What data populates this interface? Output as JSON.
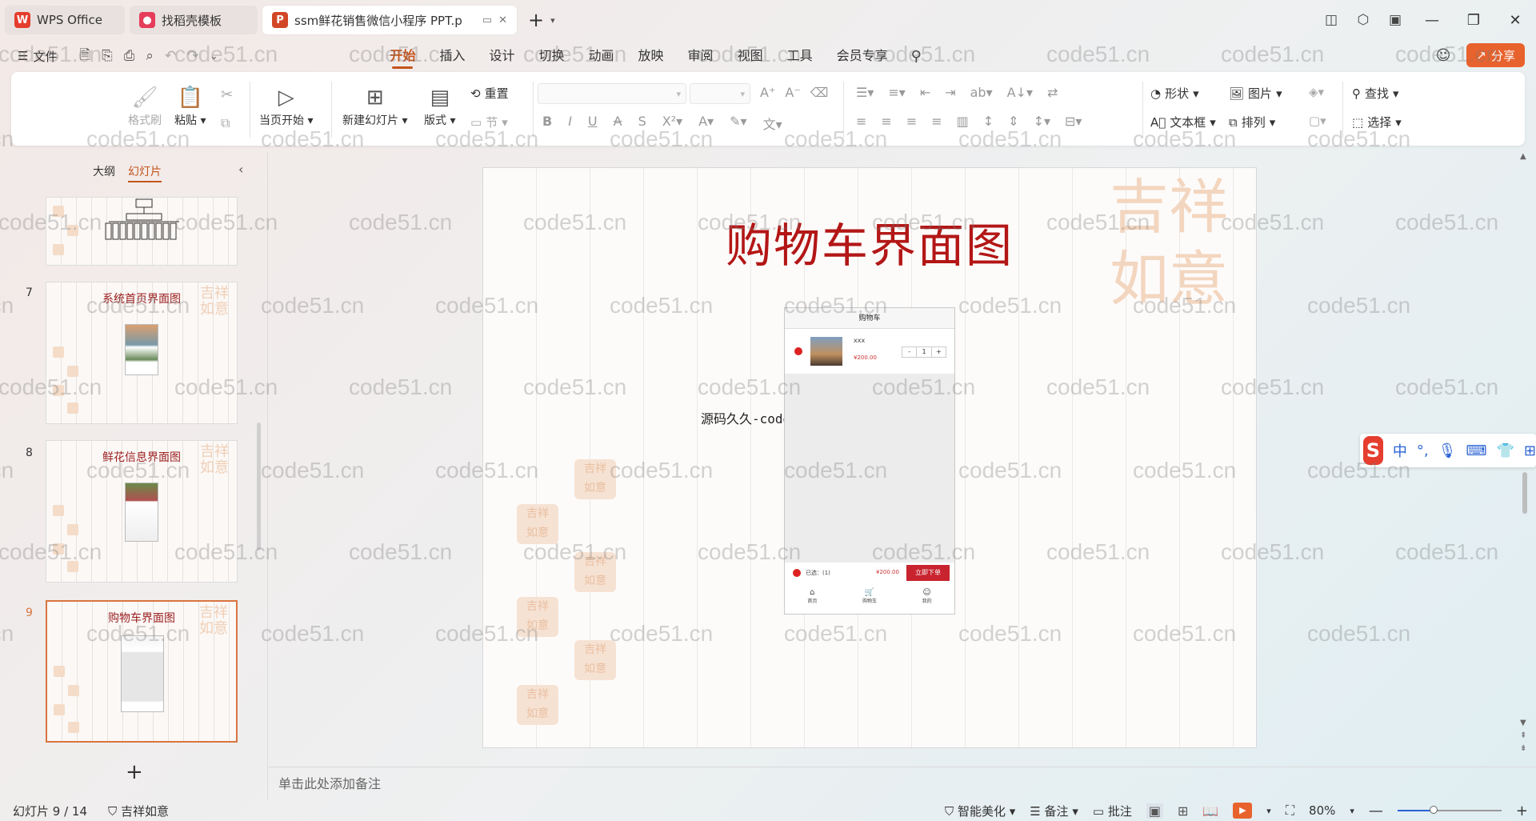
{
  "tabs": [
    {
      "label": "WPS Office",
      "icon": "wps-logo-icon",
      "color": "#e53d2e"
    },
    {
      "label": "找稻壳模板",
      "icon": "docer-logo-icon",
      "color": "#e53d5a"
    },
    {
      "label": "ssm鲜花销售微信小程序 PPT.p",
      "icon": "ppt-logo-icon",
      "color": "#d24726",
      "logo_letter": "P"
    }
  ],
  "menu": {
    "file_label": "文件",
    "tabs": [
      "开始",
      "插入",
      "设计",
      "切换",
      "动画",
      "放映",
      "审阅",
      "视图",
      "工具",
      "会员专享"
    ],
    "active_tab": "开始",
    "share_label": "分享"
  },
  "ribbon": {
    "format_painter": "格式刷",
    "paste": "粘贴",
    "play_current": "当页开始",
    "new_slide": "新建幻灯片",
    "layout": "版式",
    "reset": "重置",
    "section": "节",
    "shape": "形状",
    "picture": "图片",
    "textbox": "文本框",
    "arrange": "排列",
    "find": "查找",
    "select": "选择"
  },
  "left_panel": {
    "tab_outline": "大纲",
    "tab_slides": "幻灯片",
    "active_tab": "幻灯片",
    "thumbnails": [
      {
        "num": "7",
        "title": "系统首页界面图"
      },
      {
        "num": "8",
        "title": "鲜花信息界面图"
      },
      {
        "num": "9",
        "title": "购物车界面图",
        "selected": true
      }
    ]
  },
  "slide": {
    "title": "购物车界面图",
    "deco_text": "吉祥如意",
    "source_note": "源码久久-code99.top",
    "phone": {
      "header": "购物车",
      "item_name": "xxx",
      "item_price": "¥200.00",
      "qty_minus": "-",
      "qty": "1",
      "qty_plus": "+",
      "selected_label": "已选：(1)",
      "total": "¥200.00",
      "order_button": "立即下单",
      "nav": [
        "首页",
        "购物车",
        "我的"
      ]
    }
  },
  "notes_placeholder": "单击此处添加备注",
  "status": {
    "slide_counter": "幻灯片 9 / 14",
    "theme": "吉祥如意",
    "beautify": "智能美化",
    "notes": "备注",
    "comments": "批注",
    "zoom": "80%",
    "zoom_level": 0.35
  },
  "watermark": "code51.cn",
  "colors": {
    "accent": "#c5541c",
    "title_red": "#b31616",
    "share": "#e8622d"
  }
}
